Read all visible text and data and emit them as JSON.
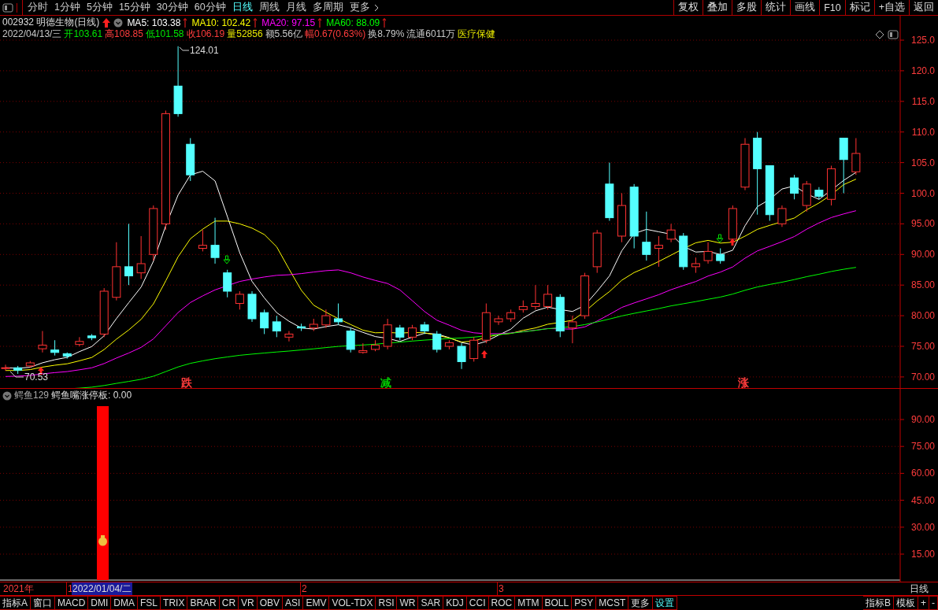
{
  "toolbar": {
    "periods": [
      {
        "label": "分时",
        "selected": false
      },
      {
        "label": "1分钟",
        "selected": false
      },
      {
        "label": "5分钟",
        "selected": false
      },
      {
        "label": "15分钟",
        "selected": false
      },
      {
        "label": "30分钟",
        "selected": false
      },
      {
        "label": "60分钟",
        "selected": false
      },
      {
        "label": "日线",
        "selected": true
      },
      {
        "label": "周线",
        "selected": false
      },
      {
        "label": "月线",
        "selected": false
      },
      {
        "label": "多周期",
        "selected": false
      },
      {
        "label": "更多",
        "selected": false
      }
    ],
    "buttons": [
      "复权",
      "叠加",
      "多股",
      "统计",
      "画线",
      "F10",
      "标记",
      "+自选",
      "返回"
    ]
  },
  "stock": {
    "code": "002932",
    "name": "明德生物(日线)",
    "ma": [
      {
        "label": "MA5: 103.38",
        "color": "#ffffff"
      },
      {
        "label": "MA10: 102.42",
        "color": "#ffff00"
      },
      {
        "label": "MA20: 97.15",
        "color": "#ff00ff"
      },
      {
        "label": "MA60: 88.09",
        "color": "#00ff00"
      }
    ]
  },
  "quote": [
    {
      "text": "2022/04/13/三",
      "color": "#c8c8c8"
    },
    {
      "text": "开103.61",
      "color": "#00e600"
    },
    {
      "text": "高108.85",
      "color": "#ff3c3c"
    },
    {
      "text": "低101.58",
      "color": "#00e600"
    },
    {
      "text": "收106.19",
      "color": "#ff3c3c"
    },
    {
      "text": "量52856",
      "color": "#e6e600"
    },
    {
      "text": "额5.56亿",
      "color": "#c8c8c8"
    },
    {
      "text": "幅0.67(0.63%)",
      "color": "#ff3c3c"
    },
    {
      "text": "换8.79%",
      "color": "#c8c8c8"
    },
    {
      "text": "流通6011万",
      "color": "#c8c8c8"
    },
    {
      "text": "医疗保健",
      "color": "#e6e600"
    }
  ],
  "chart": {
    "price_ticks": [
      "125.0",
      "120.0",
      "115.0",
      "110.0",
      "105.0",
      "100.0",
      "95.00",
      "90.00",
      "85.00",
      "80.00",
      "75.00",
      "70.00"
    ],
    "high_label": "124.01",
    "low_label": "70.53",
    "signals": [
      {
        "text": "跌",
        "color": "#ff3c3c"
      },
      {
        "text": "减",
        "color": "#00c800"
      },
      {
        "text": "涨",
        "color": "#ff3c3c"
      }
    ]
  },
  "indicator": {
    "name": "鳄鱼129",
    "formula": "鳄鱼嘴涨停板: 0.00",
    "ticks": [
      "90.00",
      "75.00",
      "60.00",
      "45.00",
      "30.00",
      "15.00"
    ]
  },
  "timeline": {
    "year": "2021年",
    "markers": [
      "1",
      "2",
      "3"
    ],
    "cursor_date": "2022/01/04/二",
    "period": "日线"
  },
  "tabs": [
    {
      "label": "指标A",
      "selected": false
    },
    {
      "label": "窗口",
      "selected": false
    },
    {
      "label": "MACD",
      "selected": false
    },
    {
      "label": "DMI",
      "selected": false
    },
    {
      "label": "DMA",
      "selected": false
    },
    {
      "label": "FSL",
      "selected": false
    },
    {
      "label": "TRIX",
      "selected": false
    },
    {
      "label": "BRAR",
      "selected": false
    },
    {
      "label": "CR",
      "selected": false
    },
    {
      "label": "VR",
      "selected": false
    },
    {
      "label": "OBV",
      "selected": false
    },
    {
      "label": "ASI",
      "selected": false
    },
    {
      "label": "EMV",
      "selected": false
    },
    {
      "label": "VOL-TDX",
      "selected": false
    },
    {
      "label": "RSI",
      "selected": false
    },
    {
      "label": "WR",
      "selected": false
    },
    {
      "label": "SAR",
      "selected": false
    },
    {
      "label": "KDJ",
      "selected": false
    },
    {
      "label": "CCI",
      "selected": false
    },
    {
      "label": "ROC",
      "selected": false
    },
    {
      "label": "MTM",
      "selected": false
    },
    {
      "label": "BOLL",
      "selected": false
    },
    {
      "label": "PSY",
      "selected": false
    },
    {
      "label": "MCST",
      "selected": false
    },
    {
      "label": "更多",
      "selected": false
    },
    {
      "label": "设置",
      "selected": true
    }
  ],
  "right_tabs": [
    "指标B",
    "模板",
    "+",
    "-"
  ]
}
